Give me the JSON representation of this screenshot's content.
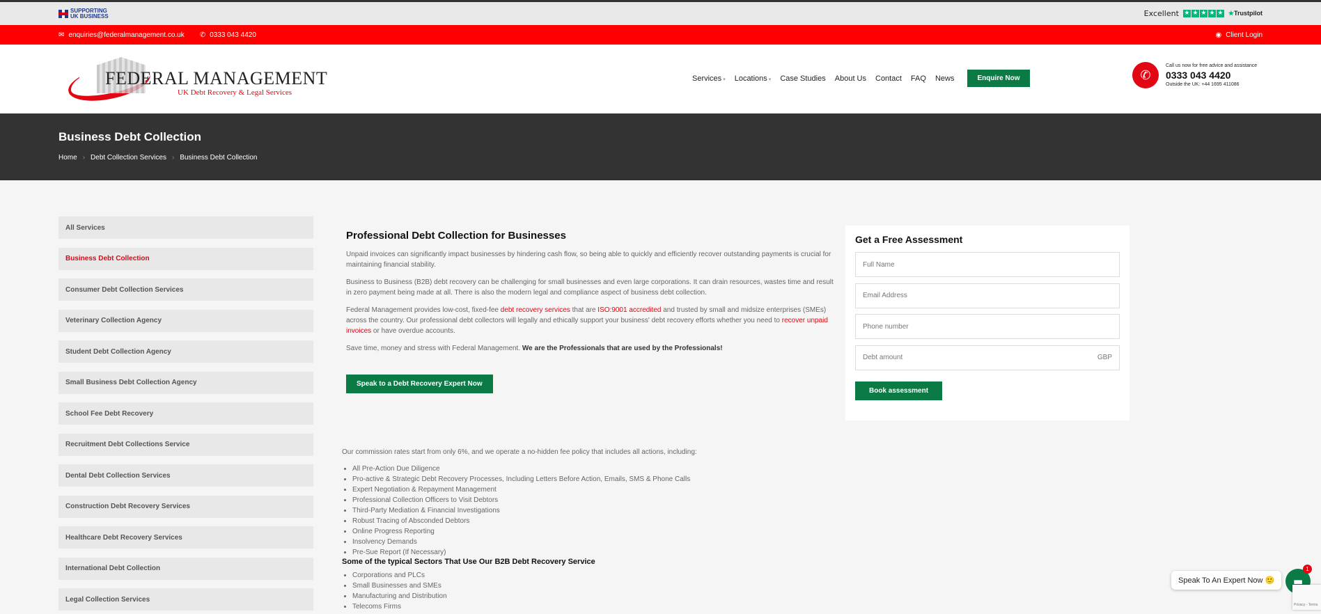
{
  "util": {
    "supporting": "SUPPORTING UK BUSINESS",
    "excellent": "Excellent",
    "trustpilot": "Trustpilot"
  },
  "redbar": {
    "email": "enquiries@federalmanagement.co.uk",
    "phone": "0333 043 4420",
    "client_login": "Client Login"
  },
  "logo": {
    "name": "FEDERAL MANAGEMENT",
    "tagline": "UK Debt Recovery & Legal Services"
  },
  "nav": {
    "items": [
      "Services",
      "Locations",
      "Case Studies",
      "About Us",
      "Contact",
      "FAQ",
      "News"
    ],
    "enquire": "Enquire Now"
  },
  "call": {
    "line1": "Call us now for free advice and assistance",
    "number": "0333 043 4420",
    "line3": "Outside the UK: +44 1695 411086"
  },
  "hero": {
    "title": "Business Debt Collection",
    "breadcrumb": [
      "Home",
      "Debt Collection Services",
      "Business Debt Collection"
    ]
  },
  "sidebar": {
    "items": [
      "All Services",
      "Business Debt Collection",
      "Consumer Debt Collection Services",
      "Veterinary Collection Agency",
      "Student Debt Collection Agency",
      "Small Business Debt Collection Agency",
      "School Fee Debt Recovery",
      "Recruitment Debt Collections Service",
      "Dental Debt Collection Services",
      "Construction Debt Recovery Services",
      "Healthcare Debt Recovery Services",
      "International Debt Collection",
      "Legal Collection Services"
    ]
  },
  "main": {
    "heading": "Professional Debt Collection for Businesses",
    "p1": "Unpaid invoices can significantly impact businesses by hindering cash flow, so being able to quickly and efficiently recover outstanding payments is crucial for maintaining financial stability.",
    "p2": "Business to Business (B2B) debt recovery can be challenging for small businesses and even large corporations. It can drain resources, wastes time and result in zero payment being made at all. There is also the modern legal and compliance aspect of business debt collection.",
    "p3a": "Federal Management provides low-cost, fixed-fee ",
    "p3_link1": "debt recovery services",
    "p3b": " that are ",
    "p3_link2": "ISO:9001 accredited",
    "p3c": " and trusted by small and midsize enterprises (SMEs) across the country. Our professional debt collectors will legally and ethically support your business' debt recovery efforts whether you need to ",
    "p3_link3": "recover unpaid invoices",
    "p3d": " or have overdue accounts.",
    "p4a": "Save time, money and stress with Federal Management. ",
    "p4b": "We are the Professionals that are used by the Professionals!",
    "cta": "Speak to a Debt Recovery Expert Now"
  },
  "lower": {
    "intro": "Our commission rates start from only 6%, and we operate a no-hidden fee policy that includes all actions, including:",
    "actions": [
      "All Pre-Action Due Diligence",
      "Pro-active & Strategic Debt Recovery Processes, Including Letters Before Action, Emails, SMS & Phone Calls",
      "Expert Negotiation & Repayment Management",
      "Professional Collection Officers to Visit Debtors",
      "Third-Party Mediation & Financial Investigations",
      "Robust Tracing of Absconded Debtors",
      "Online Progress Reporting",
      "Insolvency Demands",
      "Pre-Sue Report (If Necessary)"
    ],
    "sectors_heading": "Some of the typical Sectors That Use Our B2B Debt Recovery Service",
    "sectors": [
      "Corporations and PLCs",
      "Small Businesses and SMEs",
      "Manufacturing and Distribution",
      "Telecoms Firms"
    ]
  },
  "form": {
    "title": "Get a Free Assessment",
    "full_name": "Full Name",
    "email": "Email Address",
    "phone": "Phone number",
    "debt": "Debt amount",
    "currency": "GBP",
    "submit": "Book assessment"
  },
  "chat": {
    "label": "Speak To An Expert Now 🙂",
    "badge": "1"
  },
  "recaptcha": "Privacy - Terms"
}
